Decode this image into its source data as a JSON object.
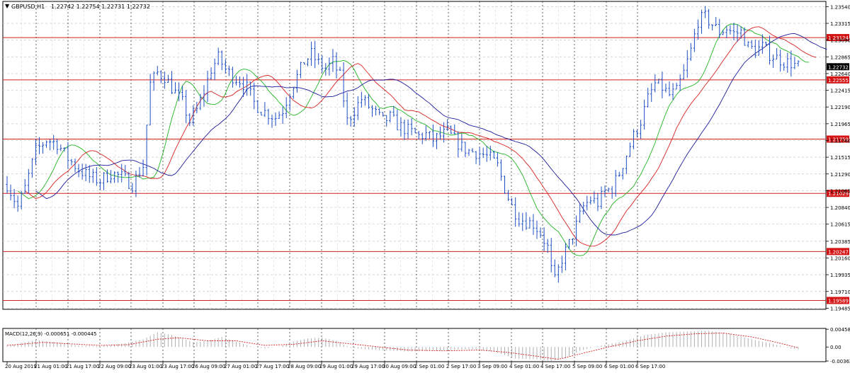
{
  "chart_data": [
    {
      "type": "line",
      "subtype": "candlestick-ohlc",
      "symbol_label": "GBPUSD,H1",
      "header": {
        "symbol": "GBPUSD,H1",
        "ohlc": "1.22742 1.22754 1.22731 1.22732"
      },
      "current_price": "1.22732",
      "y_ticks": [
        "1.23540",
        "1.23315",
        "1.23090",
        "1.22865",
        "1.22640",
        "1.22415",
        "1.22190",
        "1.21965",
        "1.21740",
        "1.21515",
        "1.21290",
        "1.21065",
        "1.20840",
        "1.20615",
        "1.20385",
        "1.20160",
        "1.19935",
        "1.19710",
        "1.19485"
      ],
      "x_ticks": [
        "20 Aug 2019",
        "21 Aug 01:00",
        "21 Aug 17:00",
        "22 Aug 09:00",
        "23 Aug 01:00",
        "23 Aug 17:00",
        "26 Aug 09:00",
        "27 Aug 01:00",
        "27 Aug 17:00",
        "28 Aug 09:00",
        "29 Aug 01:00",
        "29 Aug 17:00",
        "30 Aug 09:00",
        "2 Sep 01:00",
        "2 Sep 17:00",
        "3 Sep 09:00",
        "4 Sep 01:00",
        "4 Sep 17:00",
        "5 Sep 09:00",
        "6 Sep 01:00",
        "6 Sep 17:00"
      ],
      "ylim": [
        1.1947,
        1.2361
      ],
      "grid": true,
      "horizontal_levels": [
        {
          "label": "1.23124",
          "value": 1.23124
        },
        {
          "label": "1.22555",
          "value": 1.22555
        },
        {
          "label": "1.21759",
          "value": 1.21759
        },
        {
          "label": "1.21029",
          "value": 1.21029
        },
        {
          "label": "1.20247",
          "value": 1.20247
        },
        {
          "label": "1.19589",
          "value": 1.19589
        }
      ],
      "price_path": [
        [
          0,
          1.2115
        ],
        [
          3,
          1.2085
        ],
        [
          5,
          1.211
        ],
        [
          8,
          1.216
        ],
        [
          11,
          1.2175
        ],
        [
          14,
          1.217
        ],
        [
          17,
          1.215
        ],
        [
          20,
          1.2135
        ],
        [
          23,
          1.2125
        ],
        [
          26,
          1.212
        ],
        [
          29,
          1.213
        ],
        [
          32,
          1.2125
        ],
        [
          35,
          1.2115
        ],
        [
          38,
          1.214
        ],
        [
          40,
          1.225
        ],
        [
          42,
          1.2265
        ],
        [
          44,
          1.226
        ],
        [
          46,
          1.2245
        ],
        [
          49,
          1.2225
        ],
        [
          51,
          1.22
        ],
        [
          53,
          1.2215
        ],
        [
          55,
          1.224
        ],
        [
          57,
          1.227
        ],
        [
          59,
          1.2285
        ],
        [
          61,
          1.227
        ],
        [
          63,
          1.226
        ],
        [
          65,
          1.2255
        ],
        [
          67,
          1.2245
        ],
        [
          69,
          1.2225
        ],
        [
          71,
          1.2215
        ],
        [
          73,
          1.221
        ],
        [
          75,
          1.2205
        ],
        [
          77,
          1.2215
        ],
        [
          79,
          1.224
        ],
        [
          81,
          1.226
        ],
        [
          83,
          1.228
        ],
        [
          85,
          1.229
        ],
        [
          87,
          1.2278
        ],
        [
          89,
          1.227
        ],
        [
          91,
          1.228
        ],
        [
          93,
          1.226
        ],
        [
          95,
          1.22
        ],
        [
          97,
          1.2215
        ],
        [
          99,
          1.223
        ],
        [
          101,
          1.222
        ],
        [
          103,
          1.221
        ],
        [
          105,
          1.22
        ],
        [
          107,
          1.2205
        ],
        [
          109,
          1.2195
        ],
        [
          111,
          1.219
        ],
        [
          113,
          1.2185
        ],
        [
          115,
          1.218
        ],
        [
          117,
          1.2182
        ],
        [
          119,
          1.2175
        ],
        [
          121,
          1.218
        ],
        [
          123,
          1.2185
        ],
        [
          125,
          1.2175
        ],
        [
          127,
          1.2165
        ],
        [
          129,
          1.216
        ],
        [
          131,
          1.2158
        ],
        [
          133,
          1.2155
        ],
        [
          135,
          1.215
        ],
        [
          137,
          1.214
        ],
        [
          139,
          1.211
        ],
        [
          141,
          1.2085
        ],
        [
          143,
          1.207
        ],
        [
          145,
          1.2065
        ],
        [
          147,
          1.2062
        ],
        [
          149,
          1.205
        ],
        [
          151,
          1.203
        ],
        [
          152,
          1.2
        ],
        [
          153,
          1.1985
        ],
        [
          155,
          1.2015
        ],
        [
          157,
          1.2035
        ],
        [
          159,
          1.206
        ],
        [
          161,
          1.2085
        ],
        [
          163,
          1.2095
        ],
        [
          165,
          1.209
        ],
        [
          167,
          1.2105
        ],
        [
          169,
          1.211
        ],
        [
          171,
          1.213
        ],
        [
          173,
          1.2155
        ],
        [
          175,
          1.218
        ],
        [
          177,
          1.22
        ],
        [
          179,
          1.223
        ],
        [
          181,
          1.225
        ],
        [
          183,
          1.2245
        ],
        [
          185,
          1.2235
        ],
        [
          187,
          1.224
        ],
        [
          189,
          1.2265
        ],
        [
          191,
          1.2295
        ],
        [
          193,
          1.2335
        ],
        [
          195,
          1.234
        ],
        [
          197,
          1.233
        ],
        [
          199,
          1.232
        ],
        [
          201,
          1.2325
        ],
        [
          203,
          1.2318
        ],
        [
          205,
          1.232
        ],
        [
          207,
          1.23
        ],
        [
          209,
          1.2295
        ],
        [
          211,
          1.23
        ],
        [
          213,
          1.229
        ],
        [
          215,
          1.2285
        ],
        [
          217,
          1.228
        ],
        [
          219,
          1.2278
        ],
        [
          221,
          1.2273
        ]
      ]
    },
    {
      "type": "line",
      "subtype": "histogram-with-signal",
      "label": "MACD(12,26,9) -0.000651 -0.000445",
      "y_ticks": [
        "0.004589",
        "0.00",
        "-0.003622"
      ],
      "ylim": [
        -0.0038,
        0.0048
      ],
      "macd_key": [
        [
          0,
          0.0002
        ],
        [
          8,
          0.0018
        ],
        [
          14,
          0.0012
        ],
        [
          20,
          0.0004
        ],
        [
          26,
          0.0002
        ],
        [
          32,
          0.0008
        ],
        [
          38,
          0.002
        ],
        [
          42,
          0.0038
        ],
        [
          46,
          0.0031
        ],
        [
          52,
          0.0012
        ],
        [
          56,
          0.0016
        ],
        [
          60,
          0.0026
        ],
        [
          64,
          0.0014
        ],
        [
          68,
          0.0002
        ],
        [
          72,
          -0.0004
        ],
        [
          76,
          0.0001
        ],
        [
          80,
          0.0014
        ],
        [
          84,
          0.0022
        ],
        [
          88,
          0.0024
        ],
        [
          92,
          0.0016
        ],
        [
          96,
          -0.0002
        ],
        [
          100,
          -0.0006
        ],
        [
          106,
          -0.0009
        ],
        [
          112,
          -0.0012
        ],
        [
          118,
          -0.001
        ],
        [
          124,
          -0.0008
        ],
        [
          130,
          -0.0006
        ],
        [
          136,
          -0.0012
        ],
        [
          142,
          -0.003
        ],
        [
          148,
          -0.0032
        ],
        [
          152,
          -0.0036
        ],
        [
          156,
          -0.0028
        ],
        [
          160,
          -0.001
        ],
        [
          166,
          0.0004
        ],
        [
          172,
          0.0014
        ],
        [
          178,
          0.003
        ],
        [
          184,
          0.0038
        ],
        [
          190,
          0.004
        ],
        [
          196,
          0.0042
        ],
        [
          202,
          0.0034
        ],
        [
          208,
          0.002
        ],
        [
          214,
          0.0008
        ],
        [
          219,
          -0.0004
        ],
        [
          221,
          -0.0006
        ]
      ],
      "signal_key": [
        [
          0,
          0.0004
        ],
        [
          10,
          0.0012
        ],
        [
          18,
          0.0008
        ],
        [
          26,
          0.0004
        ],
        [
          34,
          0.0006
        ],
        [
          42,
          0.002
        ],
        [
          48,
          0.0024
        ],
        [
          56,
          0.0016
        ],
        [
          64,
          0.0016
        ],
        [
          72,
          0.0004
        ],
        [
          80,
          0.0007
        ],
        [
          88,
          0.0016
        ],
        [
          96,
          0.0008
        ],
        [
          104,
          0.0
        ],
        [
          112,
          -0.0008
        ],
        [
          122,
          -0.001
        ],
        [
          132,
          -0.0008
        ],
        [
          140,
          -0.0014
        ],
        [
          148,
          -0.0024
        ],
        [
          154,
          -0.0032
        ],
        [
          160,
          -0.0018
        ],
        [
          168,
          0.0
        ],
        [
          176,
          0.0016
        ],
        [
          184,
          0.0028
        ],
        [
          192,
          0.0034
        ],
        [
          200,
          0.0036
        ],
        [
          208,
          0.0026
        ],
        [
          214,
          0.0014
        ],
        [
          221,
          -0.0002
        ]
      ]
    }
  ]
}
